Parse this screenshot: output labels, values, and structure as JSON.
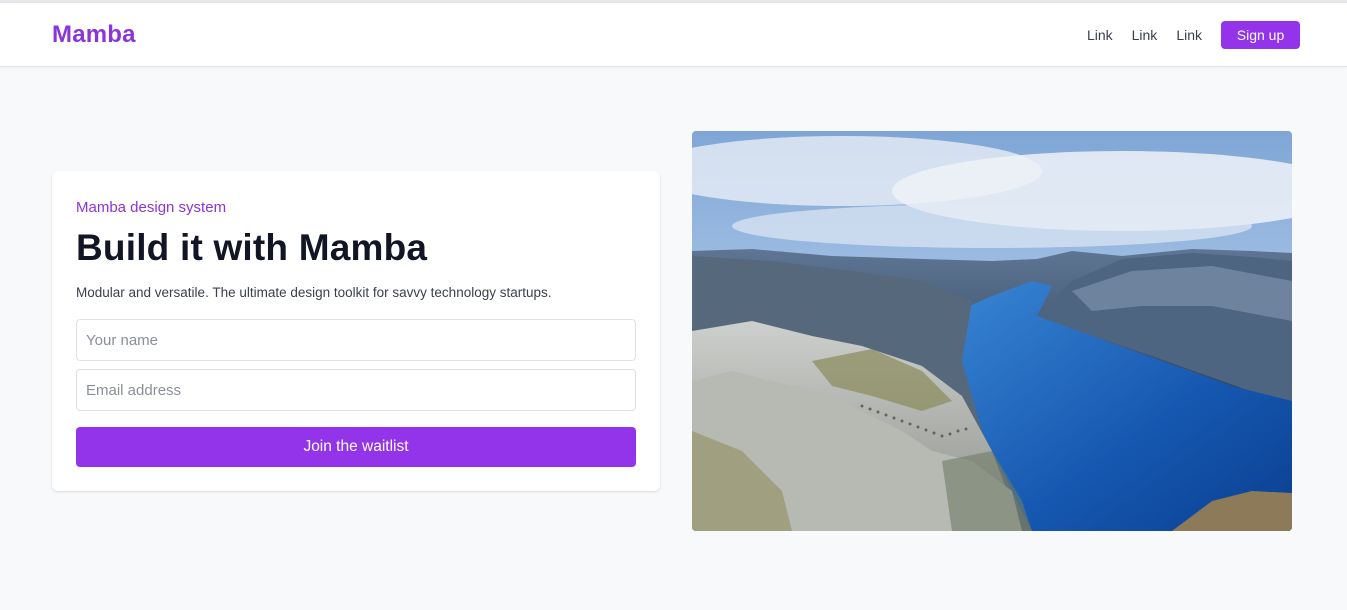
{
  "navbar": {
    "brand": "Mamba",
    "links": [
      "Link",
      "Link",
      "Link"
    ],
    "signup_label": "Sign up"
  },
  "hero": {
    "eyebrow": "Mamba design system",
    "title": "Build it with Mamba",
    "subtitle": "Modular and versatile. The ultimate design toolkit for savvy technology startups.",
    "name_placeholder": "Your name",
    "email_placeholder": "Email address",
    "cta_label": "Join the waitlist"
  },
  "image": {
    "icon": "landscape-photo-fjord-cliff"
  },
  "colors": {
    "accent": "#9333ea",
    "brand": "#8a35d8",
    "page_background": "#f8f9fb",
    "heading": "#111524"
  }
}
